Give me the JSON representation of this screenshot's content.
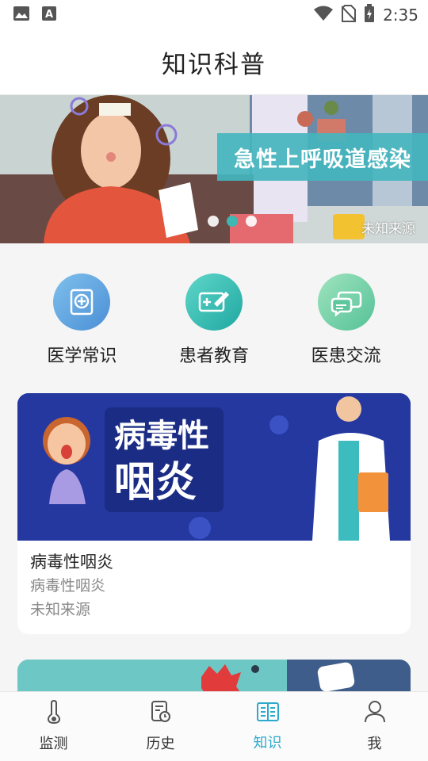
{
  "status_bar": {
    "time": "2:35"
  },
  "header": {
    "title": "知识科普"
  },
  "banner": {
    "title": "急性上呼吸道感染",
    "source": "未知来源",
    "active_dot": 1
  },
  "categories": [
    {
      "label": "医学常识",
      "icon": "medical-book-icon",
      "color": "#5fa8e0"
    },
    {
      "label": "患者教育",
      "icon": "education-card-icon",
      "color": "#3cc1b6"
    },
    {
      "label": "医患交流",
      "icon": "chat-bubbles-icon",
      "color": "#7dd3a8"
    }
  ],
  "article": {
    "image_text_line1": "病毒性",
    "image_text_line2": "咽炎",
    "title": "病毒性咽炎",
    "summary": "病毒性咽炎",
    "source": "未知来源"
  },
  "bottom_nav": {
    "items": [
      {
        "label": "监测",
        "icon": "thermometer-icon"
      },
      {
        "label": "历史",
        "icon": "history-icon"
      },
      {
        "label": "知识",
        "icon": "book-icon"
      },
      {
        "label": "我",
        "icon": "user-icon"
      }
    ],
    "active_index": 2,
    "active_color": "#2ca9cc"
  }
}
